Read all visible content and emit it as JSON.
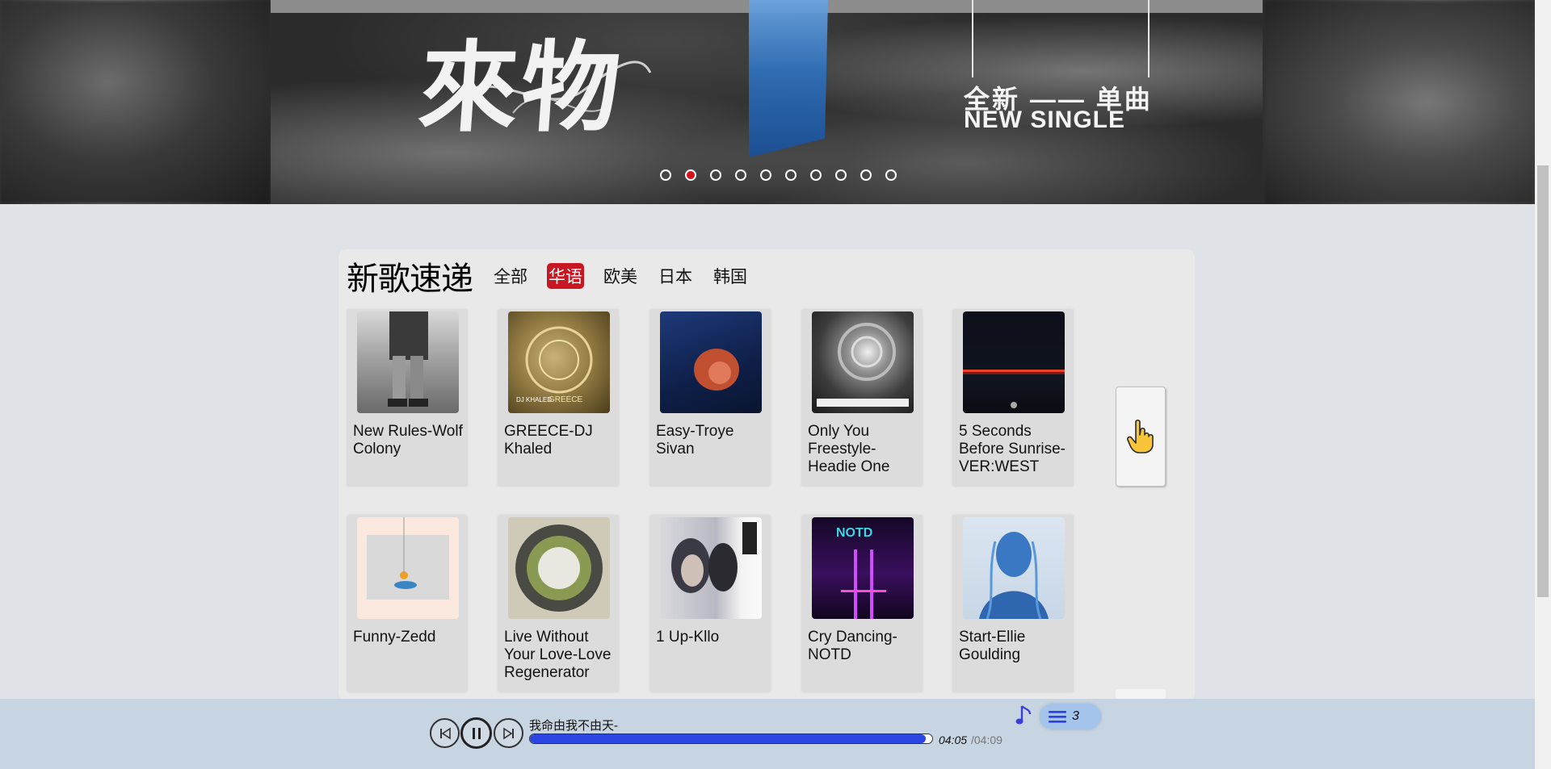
{
  "banner": {
    "title": "來物",
    "subtitle_cn": "全新 —— 单曲",
    "subtitle_en": "NEW SINGLE",
    "slide_count": 10,
    "active_slide": 2
  },
  "section": {
    "title": "新歌速递",
    "tabs": [
      {
        "label": "全部",
        "active": false
      },
      {
        "label": "华语",
        "active": true
      },
      {
        "label": "欧美",
        "active": false
      },
      {
        "label": "日本",
        "active": false
      },
      {
        "label": "韩国",
        "active": false
      }
    ],
    "accent_color": "#c81623"
  },
  "songs": [
    {
      "label": "New Rules-Wolf Colony",
      "cover_icon": "album-cover-new-rules"
    },
    {
      "label": "GREECE-DJ Khaled",
      "cover_icon": "album-cover-greece"
    },
    {
      "label": "Easy-Troye Sivan",
      "cover_icon": "album-cover-easy"
    },
    {
      "label": "Only You Freestyle-Headie One",
      "cover_icon": "album-cover-only-you-freestyle"
    },
    {
      "label": "5 Seconds Before Sunrise-VER:WEST",
      "cover_icon": "album-cover-5-seconds"
    },
    {
      "label": "Funny-Zedd",
      "cover_icon": "album-cover-funny"
    },
    {
      "label": "Live Without Your Love-Love Regenerator",
      "cover_icon": "album-cover-live-without-your-love"
    },
    {
      "label": "1 Up-Kllo",
      "cover_icon": "album-cover-1-up"
    },
    {
      "label": "Cry Dancing-NOTD",
      "cover_icon": "album-cover-cry-dancing"
    },
    {
      "label": "Start-Ellie Goulding",
      "cover_icon": "album-cover-start"
    }
  ],
  "next_button": {
    "icon": "pointing-hand-icon"
  },
  "player": {
    "song_title": "我命由我不由天-",
    "current_time": "04:05",
    "total_time": "/04:09",
    "progress": 0.984,
    "playlist_count": "3",
    "progress_color": "#2c46e4"
  }
}
